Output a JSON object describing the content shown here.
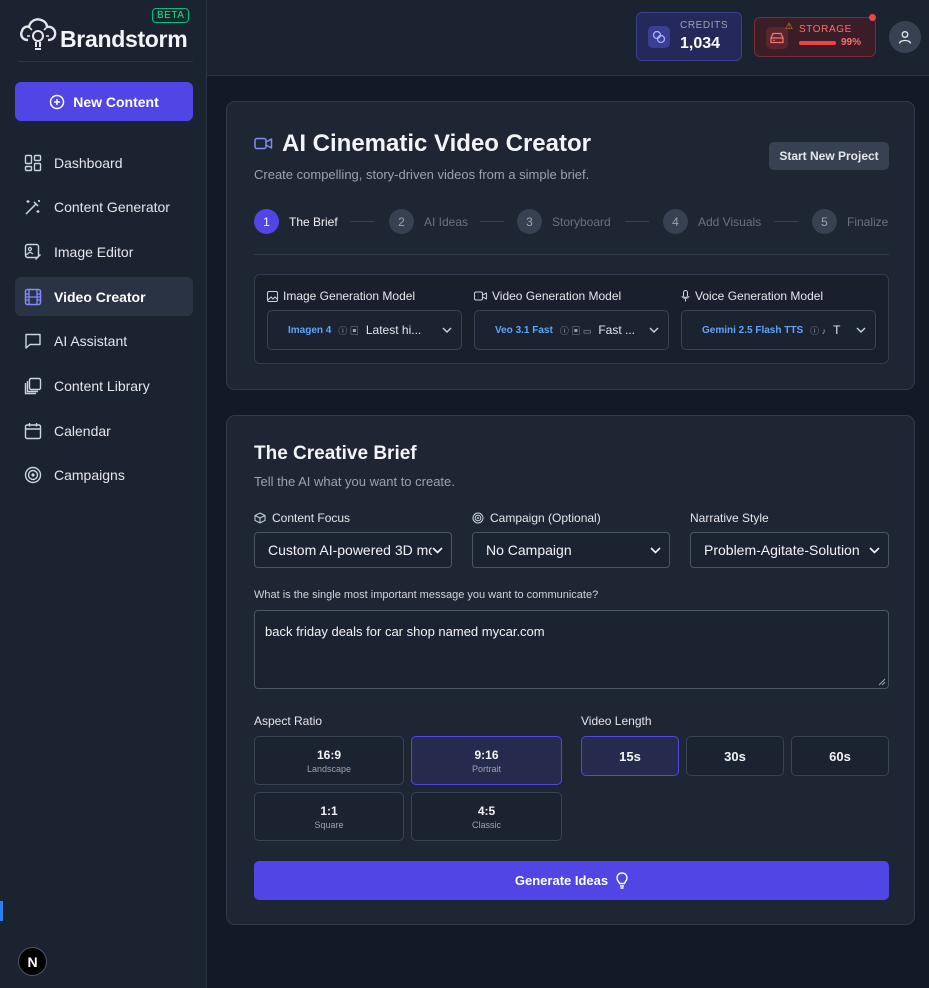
{
  "brand": {
    "name": "Brandstorm",
    "badge": "BETA"
  },
  "sidebar": {
    "new_content": "New Content",
    "items": [
      {
        "label": "Dashboard",
        "icon": "dashboard-icon"
      },
      {
        "label": "Content Generator",
        "icon": "wand-icon"
      },
      {
        "label": "Image Editor",
        "icon": "image-edit-icon"
      },
      {
        "label": "Video Creator",
        "icon": "film-icon",
        "active": true
      },
      {
        "label": "AI Assistant",
        "icon": "chat-icon"
      },
      {
        "label": "Content Library",
        "icon": "library-icon"
      },
      {
        "label": "Calendar",
        "icon": "calendar-icon"
      },
      {
        "label": "Campaigns",
        "icon": "target-icon"
      }
    ],
    "footer_badge": "N"
  },
  "header": {
    "credits": {
      "label": "CREDITS",
      "value": "1,034"
    },
    "storage": {
      "label": "STORAGE",
      "percent": "99%",
      "fill": 0.99
    }
  },
  "creator": {
    "title": "AI Cinematic Video Creator",
    "subtitle": "Create compelling, story-driven videos from a simple brief.",
    "start_button": "Start New Project",
    "steps": [
      {
        "num": "1",
        "label": "The Brief"
      },
      {
        "num": "2",
        "label": "AI Ideas"
      },
      {
        "num": "3",
        "label": "Storyboard"
      },
      {
        "num": "4",
        "label": "Add Visuals"
      },
      {
        "num": "5",
        "label": "Finalize"
      }
    ],
    "models": {
      "image": {
        "label": "Image Generation Model",
        "name": "Imagen 4",
        "desc": "Latest hi..."
      },
      "video": {
        "label": "Video Generation Model",
        "name": "Veo 3.1 Fast",
        "desc": "Fast ..."
      },
      "voice": {
        "label": "Voice Generation Model",
        "name": "Gemini 2.5 Flash TTS",
        "desc": "T"
      }
    }
  },
  "brief": {
    "title": "The Creative Brief",
    "subtitle": "Tell the AI what you want to create.",
    "content_focus": {
      "label": "Content Focus",
      "value": "Custom AI-powered 3D mo"
    },
    "campaign": {
      "label": "Campaign (Optional)",
      "value": "No Campaign"
    },
    "narrative": {
      "label": "Narrative Style",
      "value": "Problem-Agitate-Solution"
    },
    "message_label": "What is the single most important message you want to communicate?",
    "message_value": "back friday deals for car shop named mycar.com",
    "aspect_label": "Aspect Ratio",
    "aspects": [
      {
        "ratio": "16:9",
        "name": "Landscape"
      },
      {
        "ratio": "9:16",
        "name": "Portrait",
        "selected": true
      },
      {
        "ratio": "1:1",
        "name": "Square"
      },
      {
        "ratio": "4:5",
        "name": "Classic"
      }
    ],
    "length_label": "Video Length",
    "lengths": [
      "15s",
      "30s",
      "60s"
    ],
    "generate_button": "Generate Ideas"
  },
  "colors": {
    "accent": "#5145e5",
    "danger": "#ef4444",
    "link": "#60a5fa"
  }
}
